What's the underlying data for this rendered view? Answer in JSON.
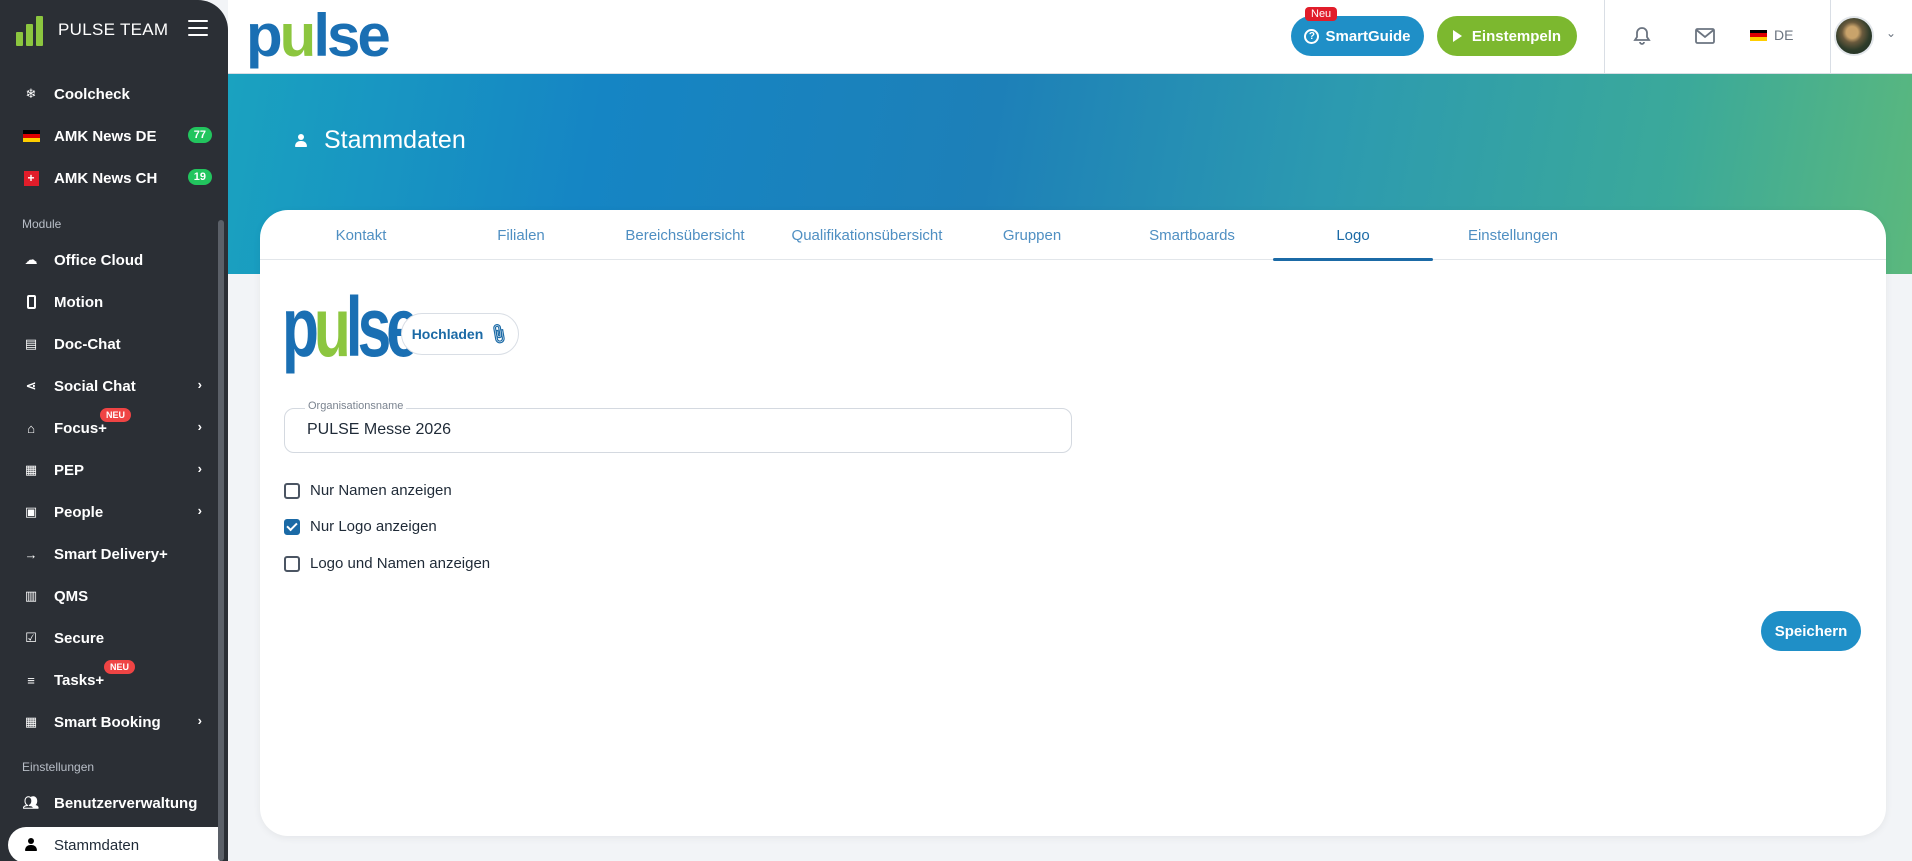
{
  "sidebar": {
    "brand": "PULSE TEAM",
    "items_top": [
      {
        "label": "Coolcheck",
        "icon": "snowflake-icon"
      },
      {
        "label": "AMK News DE",
        "icon": "flag-de-icon",
        "badge": "77"
      },
      {
        "label": "AMK News CH",
        "icon": "flag-ch-icon",
        "badge": "19"
      }
    ],
    "section_module": "Module",
    "modules": [
      {
        "label": "Office Cloud",
        "icon": "cloud-icon"
      },
      {
        "label": "Motion",
        "icon": "phone-icon"
      },
      {
        "label": "Doc-Chat",
        "icon": "chat-icon"
      },
      {
        "label": "Social Chat",
        "icon": "share-icon"
      },
      {
        "label": "Focus+",
        "icon": "graduation-cap-icon",
        "badge": "NEU"
      },
      {
        "label": "PEP",
        "icon": "clipboard-icon"
      },
      {
        "label": "People",
        "icon": "id-card-icon"
      },
      {
        "label": "Smart Delivery+",
        "icon": "arrow-right-icon"
      },
      {
        "label": "QMS",
        "icon": "library-icon"
      },
      {
        "label": "Secure",
        "icon": "checkbox-icon"
      },
      {
        "label": "Tasks+",
        "icon": "list-icon",
        "badge": "NEU"
      },
      {
        "label": "Smart Booking",
        "icon": "calendar-icon"
      }
    ],
    "section_settings": "Einstellungen",
    "settings": [
      {
        "label": "Benutzerverwaltung",
        "icon": "users-icon"
      },
      {
        "label": "Stammdaten",
        "icon": "person-icon"
      }
    ]
  },
  "topbar": {
    "logo_p": "p",
    "logo_u": "u",
    "logo_lse": "lse",
    "new_tag": "Neu",
    "smartguide_label": "SmartGuide",
    "einstempeln_label": "Einstempeln",
    "language": "DE"
  },
  "page": {
    "title": "Stammdaten"
  },
  "tabs": [
    "Kontakt",
    "Filialen",
    "Bereichsübersicht",
    "Qualifikationsübersicht",
    "Gruppen",
    "Smartboards",
    "Logo",
    "Einstellungen"
  ],
  "active_tab": "Logo",
  "form": {
    "upload_label": "Hochladen",
    "org_label": "Organisationsname",
    "org_value": "PULSE Messe 2026",
    "options": [
      {
        "label": "Nur Namen anzeigen",
        "checked": false
      },
      {
        "label": "Nur Logo anzeigen",
        "checked": true
      },
      {
        "label": "Logo und Namen anzeigen",
        "checked": false
      }
    ],
    "save_label": "Speichern"
  },
  "colors": {
    "primary": "#1b6aa6",
    "accent_green": "#8cc63f",
    "sidebar_bg": "#2b2f35",
    "badge_green": "#22c55e",
    "badge_red": "#ef4444"
  }
}
